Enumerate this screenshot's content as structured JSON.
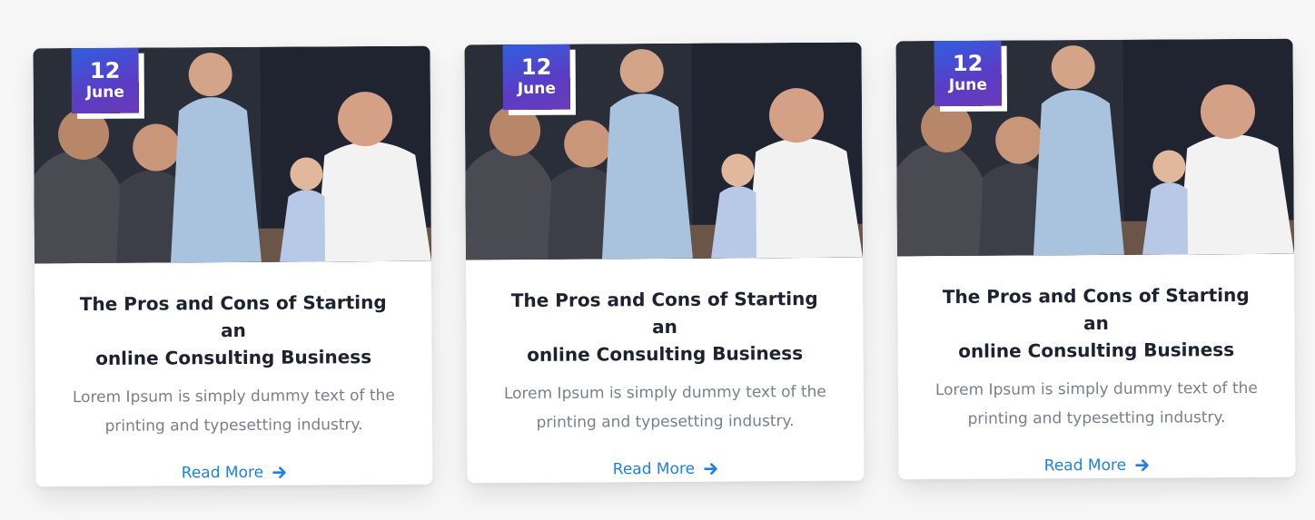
{
  "cards": [
    {
      "date_day": "12",
      "date_month": "June",
      "title_line1": "The Pros and Cons of Starting an",
      "title_line2": "online Consulting Business",
      "text_line1": "Lorem Ipsum is simply dummy text of the",
      "text_line2": "printing and typesetting industry.",
      "link_label": "Read More"
    },
    {
      "date_day": "12",
      "date_month": "June",
      "title_line1": "The Pros and Cons of Starting an",
      "title_line2": "online Consulting Business",
      "text_line1": "Lorem Ipsum is simply dummy text of the",
      "text_line2": "printing and typesetting industry.",
      "link_label": "Read More"
    },
    {
      "date_day": "12",
      "date_month": "June",
      "title_line1": "The Pros and Cons of Starting an",
      "title_line2": "online Consulting Business",
      "text_line1": "Lorem Ipsum is simply dummy text of the",
      "text_line2": "printing and typesetting industry.",
      "link_label": "Read More"
    }
  ],
  "icons": {
    "link_arrow": "arrow-right-icon"
  },
  "colors": {
    "accent": "#1e7fe8",
    "badge_start": "#2f5fe0",
    "badge_end": "#6a3bb8",
    "title": "#1e2230",
    "body_text": "#7b7f88"
  }
}
